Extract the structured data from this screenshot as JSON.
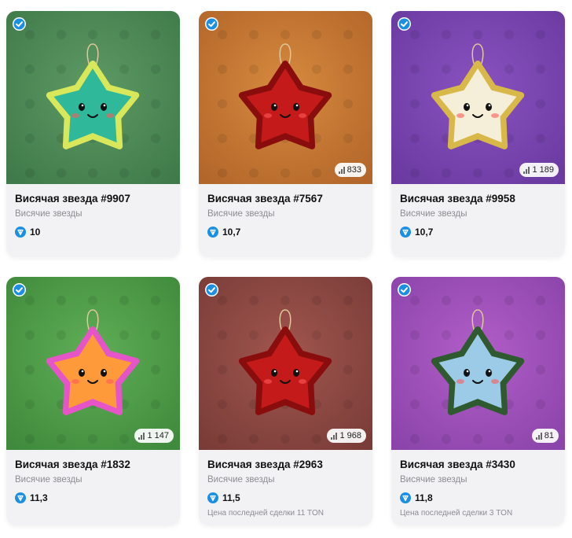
{
  "cards": [
    {
      "title": "Висячая звезда #9907",
      "collection": "Висячие звезды",
      "price": "10",
      "count": "",
      "last_sale": "",
      "bg1": "#5e9a64",
      "bg2": "#3f7a4a",
      "star": "#2fb89a",
      "rim": "#d8e85a"
    },
    {
      "title": "Висячая звезда #7567",
      "collection": "Висячие звезды",
      "price": "10,7",
      "count": "833",
      "last_sale": "",
      "bg1": "#d78a3e",
      "bg2": "#b2662a",
      "star": "#c41a1a",
      "rim": "#8a0d0d"
    },
    {
      "title": "Висячая звезда #9958",
      "collection": "Висячие звезды",
      "price": "10,7",
      "count": "1 189",
      "last_sale": "",
      "bg1": "#8a52c0",
      "bg2": "#6a3aa0",
      "star": "#f5eed8",
      "rim": "#d9b84a"
    },
    {
      "title": "Висячая звезда #1832",
      "collection": "Висячие звезды",
      "price": "11,3",
      "count": "1 147",
      "last_sale": "",
      "bg1": "#5fae56",
      "bg2": "#3f8a3c",
      "star": "#ff9a3a",
      "rim": "#e655c8"
    },
    {
      "title": "Висячая звезда #2963",
      "collection": "Висячие звезды",
      "price": "11,5",
      "count": "1 968",
      "last_sale": "Цена последней сделки 11 TON",
      "bg1": "#a0564e",
      "bg2": "#7a3c38",
      "star": "#c41a1a",
      "rim": "#8a0d0d"
    },
    {
      "title": "Висячая звезда #3430",
      "collection": "Висячие звезды",
      "price": "11,8",
      "count": "81",
      "last_sale": "Цена последней сделки 3 TON",
      "bg1": "#b25ec8",
      "bg2": "#8a44aa",
      "star": "#9ccbe8",
      "rim": "#2f5a2f"
    }
  ]
}
